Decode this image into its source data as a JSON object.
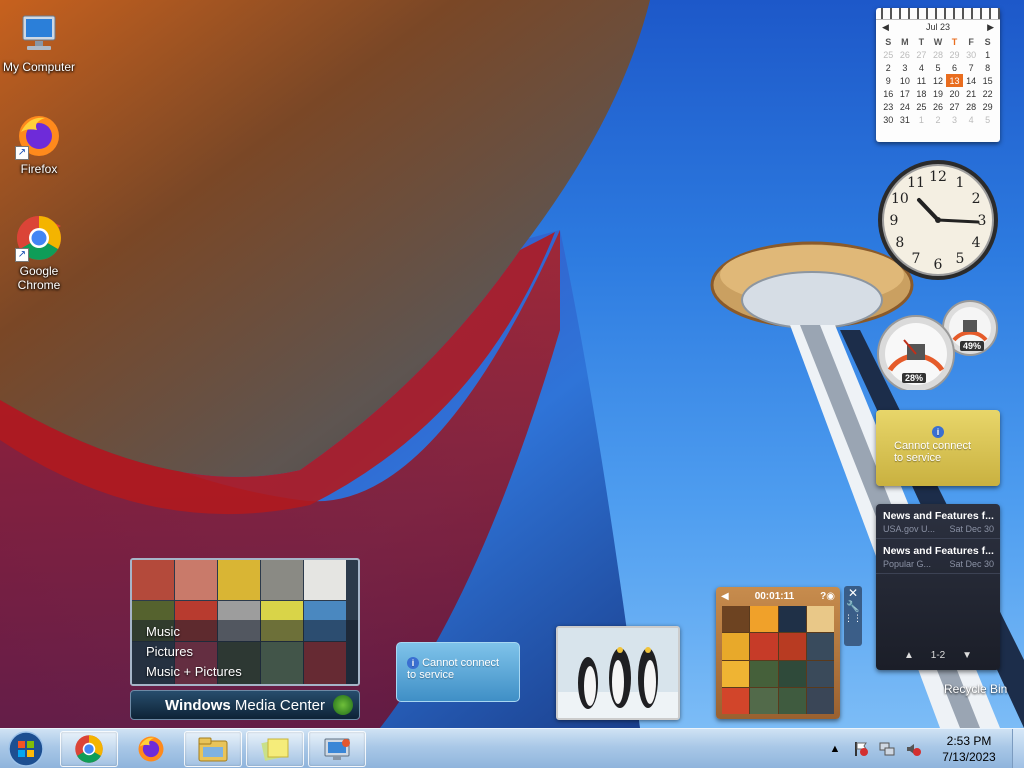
{
  "desktop": {
    "icons": [
      {
        "label": "My Computer",
        "icon": "computer-icon"
      },
      {
        "label": "Firefox",
        "icon": "firefox-icon"
      },
      {
        "label": "Google Chrome",
        "icon": "chrome-icon"
      }
    ],
    "recycle_bin": "Recycle Bin"
  },
  "calendar": {
    "month": "Jul 23",
    "weekdays": [
      "S",
      "M",
      "T",
      "W",
      "T",
      "F",
      "S"
    ],
    "weeks": [
      [
        "25",
        "26",
        "27",
        "28",
        "29",
        "30",
        "1"
      ],
      [
        "2",
        "3",
        "4",
        "5",
        "6",
        "7",
        "8"
      ],
      [
        "9",
        "10",
        "11",
        "12",
        "13",
        "14",
        "15"
      ],
      [
        "16",
        "17",
        "18",
        "19",
        "20",
        "21",
        "22"
      ],
      [
        "23",
        "24",
        "25",
        "26",
        "27",
        "28",
        "29"
      ],
      [
        "30",
        "31",
        "1",
        "2",
        "3",
        "4",
        "5"
      ]
    ],
    "today": "13",
    "accent": "#e96d1f"
  },
  "clock": {
    "numerals": [
      "12",
      "1",
      "2",
      "3",
      "4",
      "5",
      "6",
      "7",
      "8",
      "9",
      "10",
      "11"
    ]
  },
  "cpu_meter": {
    "cpu": "28%",
    "memory": "49%"
  },
  "weather": {
    "message": "Cannot connect to service"
  },
  "currency": {
    "message": "Cannot connect to service"
  },
  "feeds": {
    "items": [
      {
        "title": "News and Features f...",
        "source": "USA.gov U...",
        "date": "Sat Dec 30"
      },
      {
        "title": "News and Features f...",
        "source": "Popular G...",
        "date": "Sat Dec 30"
      }
    ],
    "page": "1-2"
  },
  "media_center": {
    "menu": [
      "Music",
      "Pictures",
      "Music + Pictures"
    ],
    "title_bold": "Windows",
    "title_rest": " Media Center"
  },
  "puzzle": {
    "timer": "00:01:11"
  },
  "taskbar": {
    "time": "2:53 PM",
    "date": "7/13/2023",
    "buttons": [
      "chrome-icon",
      "firefox-icon",
      "explorer-icon",
      "sticky-notes-icon",
      "remote-desktop-icon"
    ]
  },
  "colors": {
    "taskbar": "#a9c8e7",
    "sky": "#2d7be0",
    "calendar_today": "#e96d1f"
  }
}
